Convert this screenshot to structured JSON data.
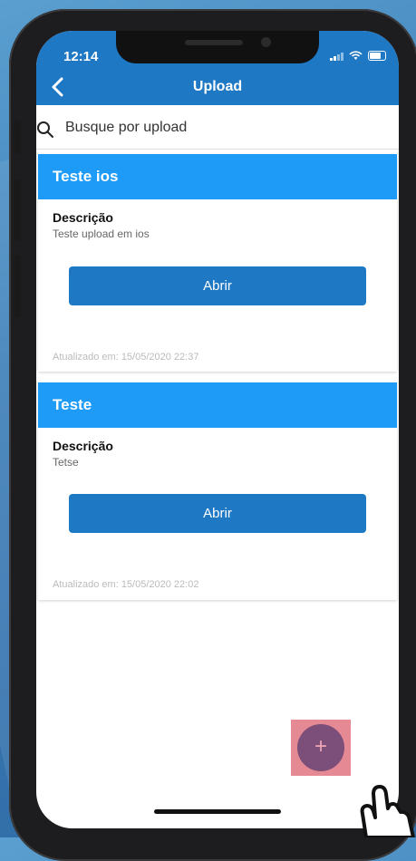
{
  "status_bar": {
    "time": "12:14"
  },
  "nav": {
    "title": "Upload"
  },
  "search": {
    "placeholder": "Busque por upload"
  },
  "cards": [
    {
      "title": "Teste ios",
      "description_label": "Descrição",
      "description": "Teste upload em ios",
      "button_label": "Abrir",
      "updated": "Atualizado em: 15/05/2020 22:37"
    },
    {
      "title": "Teste",
      "description_label": "Descrição",
      "description": "Tetse",
      "button_label": "Abrir",
      "updated": "Atualizado em: 15/05/2020 22:02"
    }
  ],
  "fab": {
    "label": "+"
  },
  "colors": {
    "primary": "#1f78c4",
    "card_header": "#1e9bf6",
    "fab": "#7b4f79",
    "fab_highlight": "#e58a95"
  }
}
